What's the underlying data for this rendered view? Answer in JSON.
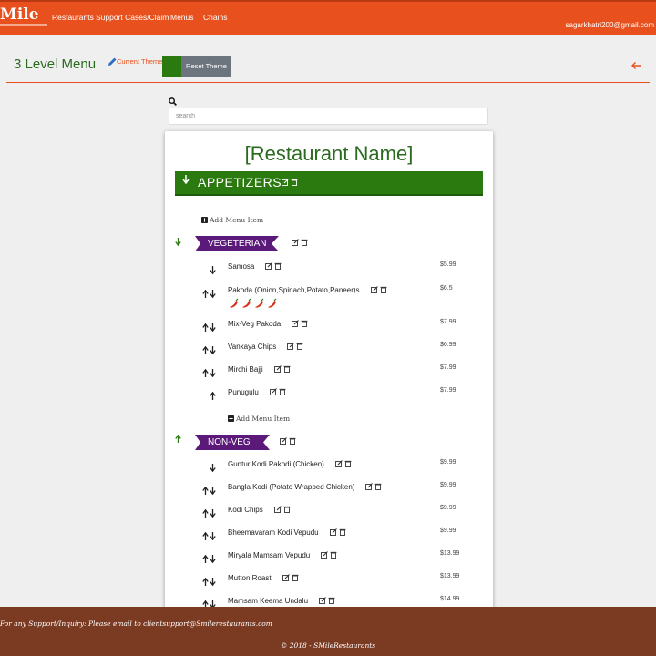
{
  "nav": {
    "brand": "Mile",
    "items": [
      "Restaurants",
      "Support Cases/Claim",
      "Menus",
      "Chains"
    ],
    "user_email": "sagarkhatri200@gmail.com"
  },
  "header": {
    "title": "3 Level Menu",
    "theme_label": "Current Theme",
    "theme_color": "#2b7a0f",
    "reset_label": "Reset Theme"
  },
  "search": {
    "placeholder": "search"
  },
  "menu": {
    "restaurant_name": "[Restaurant Name]",
    "category": "APPETIZERS",
    "add_item_label": "Add Menu Item",
    "subcategories": [
      {
        "name": "VEGETERIAN",
        "items": [
          {
            "name": "Samosa",
            "price": "$5.99"
          },
          {
            "name": "Pakoda (Onion,Spinach,Potato,Paneer)s",
            "price": "$6.5",
            "spice_level": 4
          },
          {
            "name": "Mix-Veg Pakoda",
            "price": "$7.99"
          },
          {
            "name": "Vankaya Chips",
            "price": "$6.99"
          },
          {
            "name": "Mirchi Bajji",
            "price": "$7.99"
          },
          {
            "name": "Punugulu",
            "price": "$7.99"
          }
        ]
      },
      {
        "name": "NON-VEG",
        "items": [
          {
            "name": "Guntur Kodi Pakodi (Chicken)",
            "price": "$9.99"
          },
          {
            "name": "Bangla Kodi (Potato Wrapped Chicken)",
            "price": "$9.99"
          },
          {
            "name": "Kodi Chips",
            "price": "$9.99"
          },
          {
            "name": "Bheemavaram Kodi Vepudu",
            "price": "$9.99"
          },
          {
            "name": "Miryala Mamsam Vepudu",
            "price": "$13.99"
          },
          {
            "name": "Mutton Roast",
            "price": "$13.99"
          },
          {
            "name": "Mamsam Keema Undalu",
            "price": "$14.99"
          }
        ]
      }
    ]
  },
  "footer": {
    "support_text": "For any Support/Inquiry: Please email to clientsupport@Smilerestaurants.com",
    "copyright": "© 2018 - SMileRestaurants"
  },
  "colors": {
    "primary": "#e8511d",
    "accent_green": "#2b7a0f",
    "ribbon": "#5b1a7a",
    "footer": "#7b3a22"
  }
}
